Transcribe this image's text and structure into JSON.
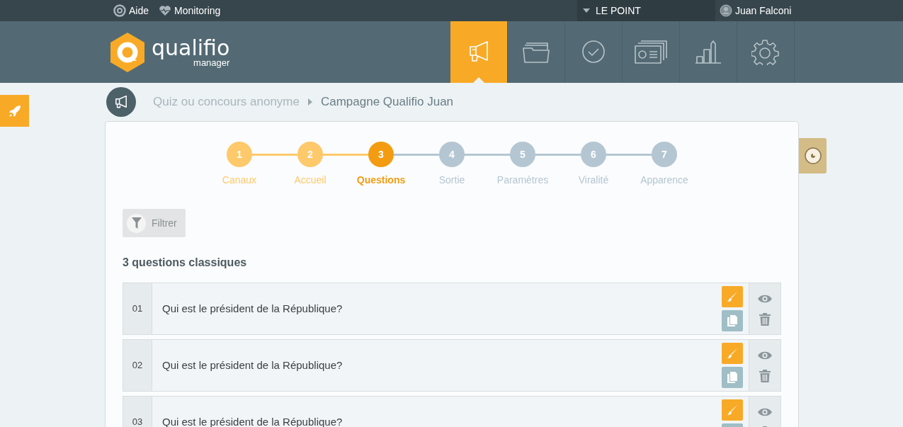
{
  "top_bar": {
    "links": [
      "Aide",
      "Monitoring"
    ],
    "account": "LE POINT",
    "user": "Juan Falconi"
  },
  "logo": {
    "name": "qualifio",
    "subtitle": "manager"
  },
  "nav_tiles": [
    {
      "selected": true
    },
    {
      "selected": false
    },
    {
      "selected": false
    },
    {
      "selected": false
    },
    {
      "selected": false
    },
    {
      "selected": false
    }
  ],
  "breadcrumb": [
    "Quiz ou concours anonyme",
    "Campagne Qualifio Juan"
  ],
  "steps": [
    {
      "number": "1",
      "label": "Canaux",
      "completed": true,
      "selected": false
    },
    {
      "number": "2",
      "label": "Accueil",
      "completed": true,
      "selected": false
    },
    {
      "number": "3",
      "label": "Questions",
      "completed": false,
      "selected": true
    },
    {
      "number": "4",
      "label": "Sortie",
      "completed": false,
      "selected": false
    },
    {
      "number": "5",
      "label": "Paramètres",
      "completed": false,
      "selected": false
    },
    {
      "number": "6",
      "label": "Viralité",
      "completed": false,
      "selected": false
    },
    {
      "number": "7",
      "label": "Apparence",
      "completed": false,
      "selected": false
    }
  ],
  "filter_button": "Filtrer",
  "section_title": "3 questions classiques",
  "questions": [
    {
      "number": "01",
      "text": "Qui est le président de la République?"
    },
    {
      "number": "02",
      "text": "Qui est le président de la République?"
    },
    {
      "number": "03",
      "text": "Qui est le président de la République?"
    }
  ]
}
